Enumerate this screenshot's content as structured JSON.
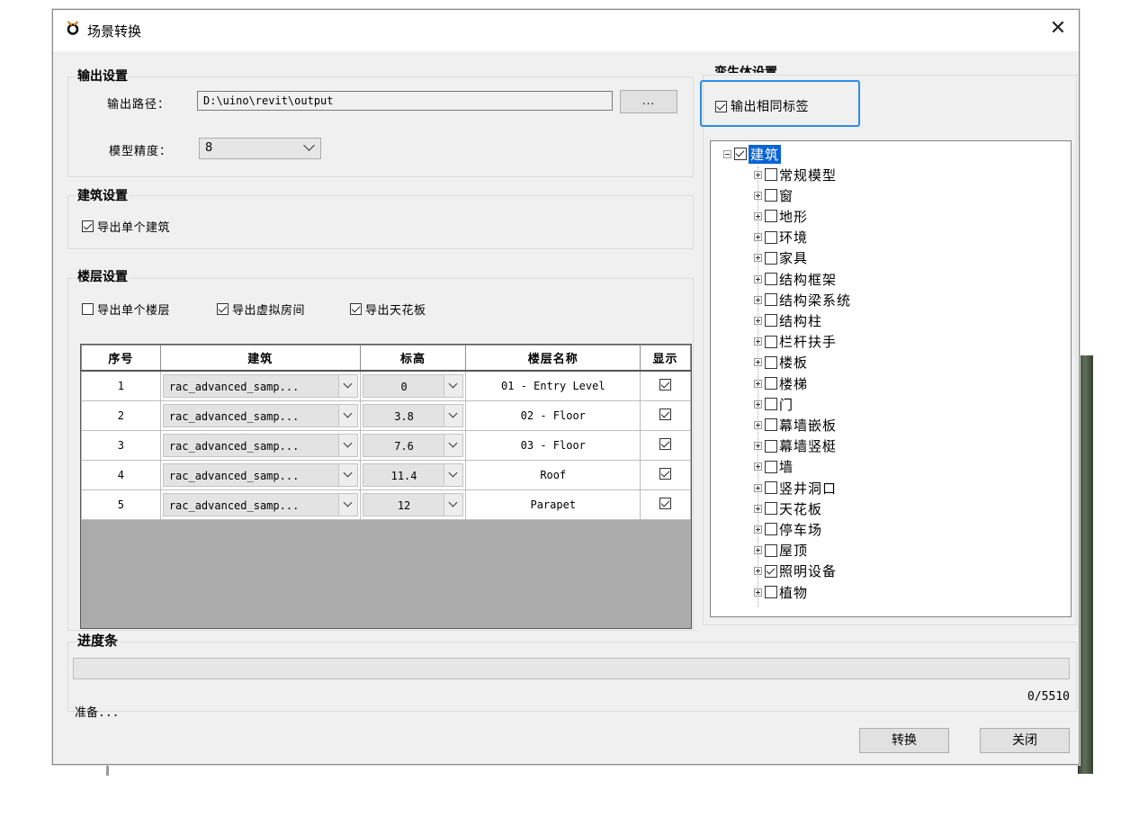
{
  "window": {
    "title": "场景转换"
  },
  "output_settings": {
    "title": "输出设置",
    "path_label": "输出路径：",
    "path_value": "D:\\uino\\revit\\output",
    "browse_label": "...",
    "precision_label": "模型精度：",
    "precision_value": "8"
  },
  "building_settings": {
    "title": "建筑设置",
    "export_single_building": {
      "label": "导出单个建筑",
      "checked": true
    }
  },
  "floor_settings": {
    "title": "楼层设置",
    "options": [
      {
        "label": "导出单个楼层",
        "checked": false
      },
      {
        "label": "导出虚拟房间",
        "checked": true
      },
      {
        "label": "导出天花板",
        "checked": true
      }
    ],
    "table": {
      "headers": [
        "序号",
        "建筑",
        "标高",
        "楼层名称",
        "显示"
      ],
      "rows": [
        {
          "index": "1",
          "building": "rac_advanced_samp...",
          "elevation": "0",
          "name": "01 - Entry Level",
          "show": true
        },
        {
          "index": "2",
          "building": "rac_advanced_samp...",
          "elevation": "3.8",
          "name": "02 - Floor",
          "show": true
        },
        {
          "index": "3",
          "building": "rac_advanced_samp...",
          "elevation": "7.6",
          "name": "03 - Floor",
          "show": true
        },
        {
          "index": "4",
          "building": "rac_advanced_samp...",
          "elevation": "11.4",
          "name": "Roof",
          "show": true
        },
        {
          "index": "5",
          "building": "rac_advanced_samp...",
          "elevation": "12",
          "name": "Parapet",
          "show": true
        }
      ]
    }
  },
  "twin_settings": {
    "title": "孪生体设置",
    "same_tag": {
      "label": "输出相同标签",
      "checked": true
    },
    "tree": {
      "root": {
        "label": "建筑",
        "checked": true,
        "expanded": true
      },
      "children": [
        {
          "label": "常规模型",
          "checked": false
        },
        {
          "label": "窗",
          "checked": false
        },
        {
          "label": "地形",
          "checked": false
        },
        {
          "label": "环境",
          "checked": false
        },
        {
          "label": "家具",
          "checked": false
        },
        {
          "label": "结构框架",
          "checked": false
        },
        {
          "label": "结构梁系统",
          "checked": false
        },
        {
          "label": "结构柱",
          "checked": false
        },
        {
          "label": "栏杆扶手",
          "checked": false
        },
        {
          "label": "楼板",
          "checked": false
        },
        {
          "label": "楼梯",
          "checked": false
        },
        {
          "label": "门",
          "checked": false
        },
        {
          "label": "幕墙嵌板",
          "checked": false
        },
        {
          "label": "幕墙竖梃",
          "checked": false
        },
        {
          "label": "墙",
          "checked": false
        },
        {
          "label": "竖井洞口",
          "checked": false
        },
        {
          "label": "天花板",
          "checked": false
        },
        {
          "label": "停车场",
          "checked": false
        },
        {
          "label": "屋顶",
          "checked": false
        },
        {
          "label": "照明设备",
          "checked": true
        },
        {
          "label": "植物",
          "checked": false
        }
      ]
    }
  },
  "progress": {
    "title": "进度条",
    "value": 0,
    "count": "0/5510",
    "status": "准备..."
  },
  "buttons": {
    "convert": "转换",
    "close": "关闭"
  },
  "colors": {
    "highlight": "#2a8dea",
    "selection": "#0a64d6",
    "table_empty": "#ababab"
  }
}
